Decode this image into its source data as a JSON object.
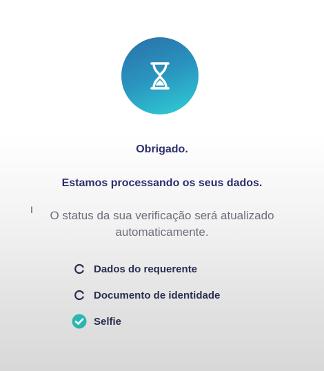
{
  "hero": {
    "icon": "hourglass-icon",
    "gradient_from": "#2b6fa8",
    "gradient_to": "#2fd0d6"
  },
  "messages": {
    "thanks": "Obrigado.",
    "processing": "Estamos processando os seus dados.",
    "status_line1": "O status da sua verificação será atualizado",
    "status_line2": "automaticamente."
  },
  "checklist": [
    {
      "label": "Dados do requerente",
      "state": "pending",
      "icon": "pending-circle-icon"
    },
    {
      "label": "Documento de identidade",
      "state": "pending",
      "icon": "pending-circle-icon"
    },
    {
      "label": "Selfie",
      "state": "done",
      "icon": "check-circle-icon",
      "color": "#2bb7b0"
    }
  ],
  "colors": {
    "heading": "#2d2f6e",
    "body_text": "#6d6f7a",
    "done": "#2bb7b0"
  }
}
